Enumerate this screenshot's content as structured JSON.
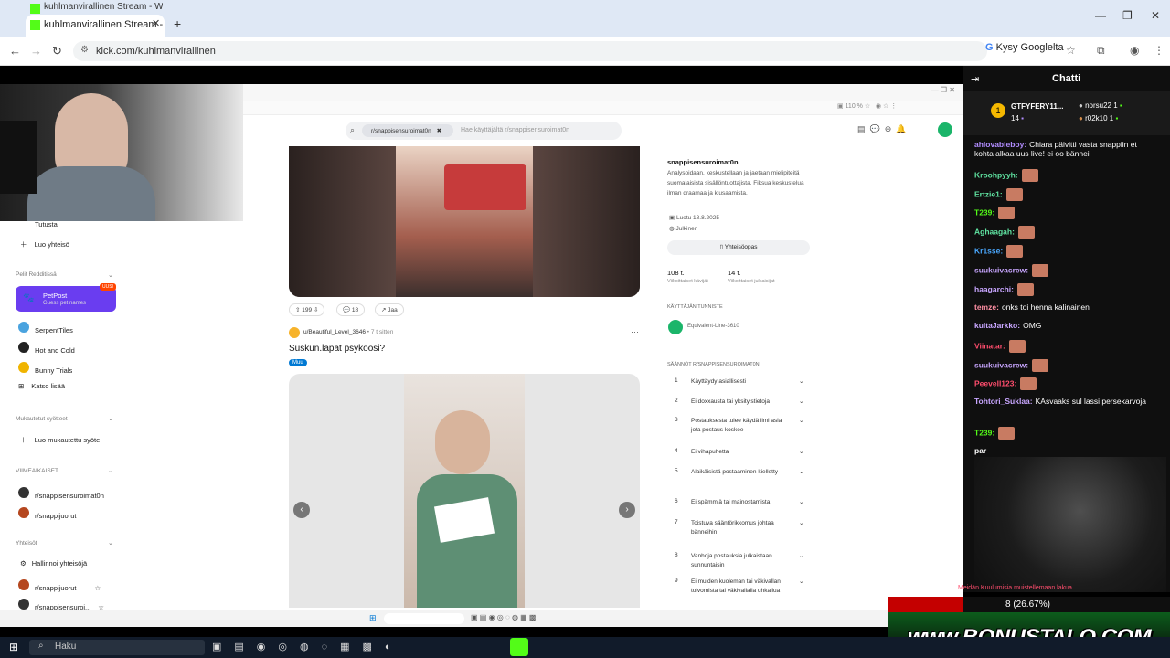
{
  "browser": {
    "tab_background_title": "kuhlmanvirallinen Stream - Wa",
    "tab_active_title": "kuhlmanvirallinen Stream - Wat",
    "url": "kick.com/kuhlmanvirallinen",
    "ask_google": "Kysy Googlelta"
  },
  "inner": {
    "search_chip": "r/snappisensuroimat0n",
    "search_placeholder": "Hae käyttäjältä r/snappisensuroimat0n",
    "sidebar": {
      "tutusta": "Tutusta",
      "luo_yhteiso": "Luo yhteisö",
      "section_pelit": "Pelit Redditissä",
      "petpost_title": "PetPost",
      "petpost_sub": "Guess pet names",
      "petpost_badge": "UUSI",
      "games": [
        "SerpentTiles",
        "Hot and Cold",
        "Bunny Trials",
        "Katso lisää"
      ],
      "section_feeds": "Mukautetut syötteet",
      "create_feed": "Luo mukautettu syöte",
      "section_recent": "VIIMEAIKAISET",
      "recent": [
        "r/snappisensuroimat0n",
        "r/snappijuorut"
      ],
      "section_communities": "Yhteisöt",
      "manage": "Hallinnoi yhteisöjä",
      "communities": [
        "r/snappijuorut",
        "r/snappisensuroi..."
      ]
    },
    "post1": {
      "score": "199",
      "comments": "18",
      "share": "Jaa"
    },
    "post2": {
      "author": "u/Beautiful_Level_3646",
      "age": "• 7 t sitten",
      "title": "Suskun.läpät psykoosi?",
      "flair": "Muu"
    },
    "sidebar_right": {
      "community": "snappisensuroimat0n",
      "description": "Analysoidaan, keskustellaan ja jaetaan mielipiteitä suomalaisista sisällöntuottajista. Fiksua keskustelua ilman draamaa ja kiusaamista.",
      "created": "Luotu 18.8.2025",
      "public": "Julkinen",
      "guide_button": "Yhteisöopas",
      "members": "108 t.",
      "members_label": "Viikoittaiset kävijät",
      "contributions": "14 t.",
      "contributions_label": "Viikoittaiset julkaisijat",
      "flair_heading": "KÄYTTÄJÄN TUNNISTE",
      "user_flair": "Equivalent-Line-3610",
      "rules_heading": "SÄÄNNÖT R/SNAPPISENSUROIMAT0N",
      "rules": [
        {
          "n": "1",
          "text": "Käyttäydy asiallisesti"
        },
        {
          "n": "2",
          "text": "Ei doxxausta tai yksityistietoja"
        },
        {
          "n": "3",
          "text": "Postauksesta tulee käydä ilmi asia jota postaus koskee"
        },
        {
          "n": "4",
          "text": "Ei vihapuhetta"
        },
        {
          "n": "5",
          "text": "Alaikäisistä postaaminen kielletty"
        },
        {
          "n": "6",
          "text": "Ei spämmiä tai mainostamista"
        },
        {
          "n": "7",
          "text": "Toistuva sääntörikkomus johtaa bänneihin"
        },
        {
          "n": "8",
          "text": "Vanhoja postauksia julkaistaan sunnuntaisin"
        },
        {
          "n": "9",
          "text": "Ei muiden kuoleman tai väkivallan toivomista tai väkivallalla uhkailua"
        }
      ]
    }
  },
  "chat": {
    "title": "Chatti",
    "top_gifter": {
      "name": "GTFYFERY11...",
      "count": "14",
      "rank": "1"
    },
    "top_others": [
      {
        "name": "norsu22",
        "count": "1"
      },
      {
        "name": "r02k10",
        "count": "1"
      }
    ],
    "messages": [
      {
        "user": "ahlovableboy:",
        "color": "#b18cff",
        "text": "Chiara päivitti vasta snappiin et kohta alkaa uus live! ei oo bännei"
      },
      {
        "user": "Kroohpyyh:",
        "color": "#5fe3a1",
        "text": ""
      },
      {
        "user": "Ertzie1:",
        "color": "#5fe3a1",
        "text": ""
      },
      {
        "user": "T239:",
        "color": "#53fc18",
        "text": ""
      },
      {
        "user": "Aghaagah:",
        "color": "#5fe3a1",
        "text": ""
      },
      {
        "user": "Kr1sse:",
        "color": "#4aa8ff",
        "text": ""
      },
      {
        "user": "suukuivacrew:",
        "color": "#c8a6ff",
        "text": ""
      },
      {
        "user": "haagarchi:",
        "color": "#c8a6ff",
        "text": ""
      },
      {
        "user": "temze:",
        "color": "#ff8fa3",
        "text": "onks toi henna kalinainen"
      },
      {
        "user": "kultaJarkko:",
        "color": "#c8a6ff",
        "text": "OMG"
      },
      {
        "user": "Viinatar:",
        "color": "#ff4d6d",
        "text": ""
      },
      {
        "user": "suukuivacrew:",
        "color": "#c8a6ff",
        "text": ""
      },
      {
        "user": "Peevell123:",
        "color": "#ff4d6d",
        "text": ""
      },
      {
        "user": "Tohtori_Suklaa:",
        "color": "#c8a6ff",
        "text": "KAsvaaks sul lassi persekarvoja"
      },
      {
        "user": "T239:",
        "color": "#53fc18",
        "text": ""
      },
      {
        "user": "par",
        "color": "#fff",
        "text": ""
      }
    ]
  },
  "overlay": {
    "poll_result": "8 (26.67%)",
    "banner": "www.BONUSTALO.COM",
    "notice": "Meidän Kuulumisia muistellemaan lakua"
  },
  "taskbar": {
    "search": "Haku"
  },
  "colors": {
    "kick_green": "#53fc18",
    "chat_bg": "#0f0f0f",
    "petpost_purple": "#6a3df0"
  }
}
